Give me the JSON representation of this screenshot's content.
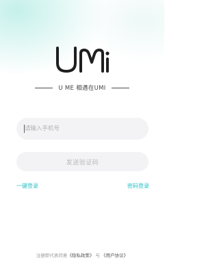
{
  "logo": {
    "text": "UMi",
    "icon": "umi-logo"
  },
  "tagline": "U ME 相遇在UMI",
  "phone_input": {
    "placeholder": "请输入手机号",
    "value": ""
  },
  "send_code_button": {
    "label": "发送验证码"
  },
  "links": {
    "one_click_login": "一键登录",
    "password_login": "密码登录"
  },
  "footer": {
    "prefix": "注册即代表同意",
    "privacy_policy": "《隐私政策》",
    "conjunction": "与",
    "user_agreement": "《用户协议》"
  },
  "colors": {
    "accent": "#27bfc4",
    "input_background": "#f3f3f5",
    "logo": "#1f1f1f"
  }
}
